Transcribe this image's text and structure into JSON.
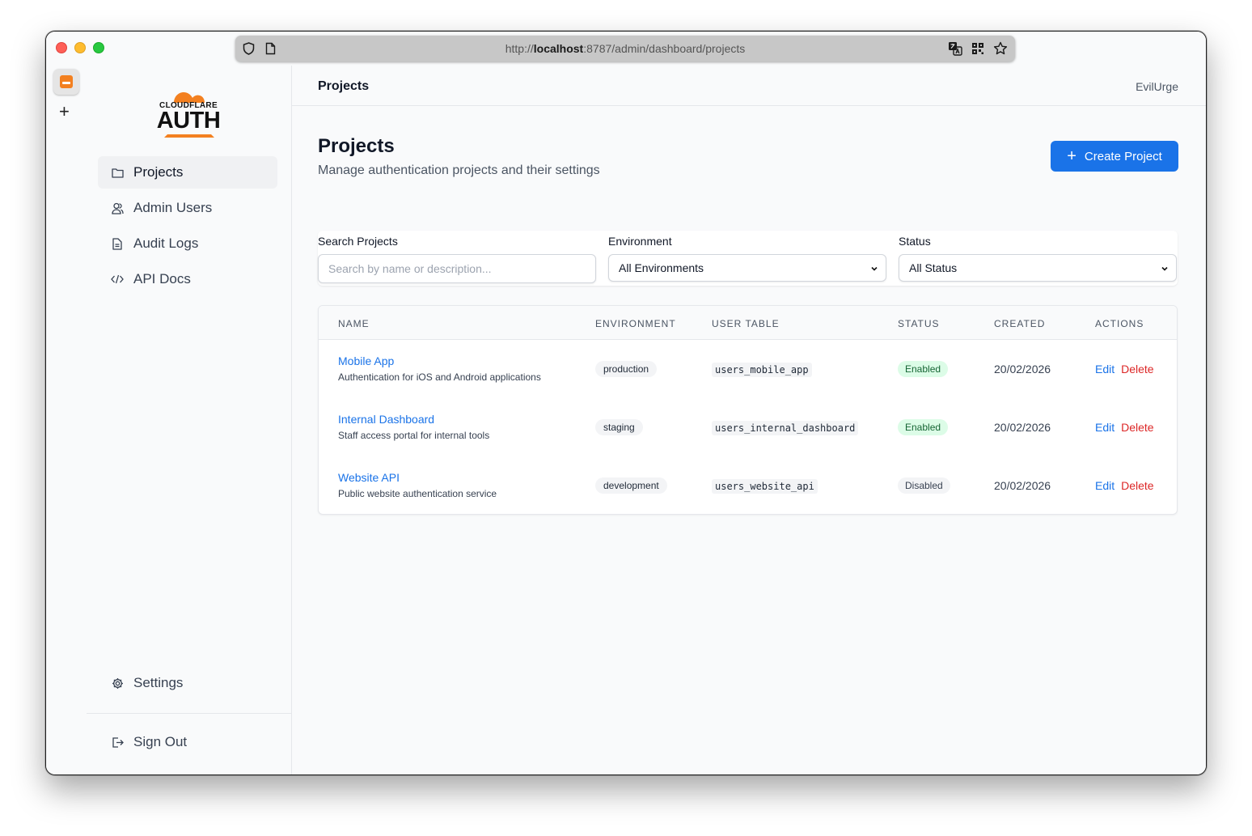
{
  "browser": {
    "url_prefix": "http://",
    "url_host": "localhost",
    "url_rest": ":8787/admin/dashboard/projects"
  },
  "sidebar": {
    "logo_top": "CLOUDFLARE",
    "logo_main": "AUTH",
    "nav": [
      {
        "label": "Projects",
        "icon": "folder-icon"
      },
      {
        "label": "Admin Users",
        "icon": "users-icon"
      },
      {
        "label": "Audit Logs",
        "icon": "document-icon"
      },
      {
        "label": "API Docs",
        "icon": "code-icon"
      }
    ],
    "settings_label": "Settings",
    "signout_label": "Sign Out"
  },
  "header": {
    "title": "Projects",
    "user": "EvilUrge"
  },
  "page": {
    "title": "Projects",
    "subtitle": "Manage authentication projects and their settings",
    "create_label": "Create Project"
  },
  "filters": {
    "search_label": "Search Projects",
    "search_placeholder": "Search by name or description...",
    "env_label": "Environment",
    "env_value": "All Environments",
    "status_label": "Status",
    "status_value": "All Status"
  },
  "table": {
    "headers": [
      "Name",
      "Environment",
      "User Table",
      "Status",
      "Created",
      "Actions"
    ],
    "edit_label": "Edit",
    "delete_label": "Delete",
    "rows": [
      {
        "name": "Mobile App",
        "description": "Authentication for iOS and Android applications",
        "environment": "production",
        "user_table": "users_mobile_app",
        "status": "Enabled",
        "created": "20/02/2026"
      },
      {
        "name": "Internal Dashboard",
        "description": "Staff access portal for internal tools",
        "environment": "staging",
        "user_table": "users_internal_dashboard",
        "status": "Enabled",
        "created": "20/02/2026"
      },
      {
        "name": "Website API",
        "description": "Public website authentication service",
        "environment": "development",
        "user_table": "users_website_api",
        "status": "Disabled",
        "created": "20/02/2026"
      }
    ]
  },
  "colors": {
    "accent": "#1a73e8",
    "danger": "#dc2626",
    "enabled_bg": "#dcfce7",
    "brand_orange": "#f38020"
  }
}
